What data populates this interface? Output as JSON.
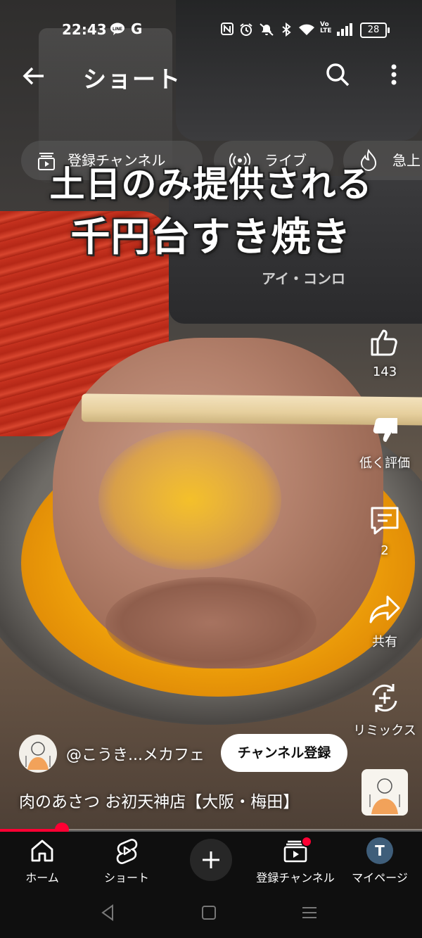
{
  "status_bar": {
    "time": "22:43",
    "line_icon_text": "LINE",
    "google_icon_text": "G",
    "battery_level": "28",
    "volte_text": "Vo LTE"
  },
  "header": {
    "title": "ショート"
  },
  "chips": [
    {
      "label": "登録チャンネル",
      "icon": "subscriptions-icon"
    },
    {
      "label": "ライブ",
      "icon": "live-icon"
    },
    {
      "label": "急上",
      "icon": "trending-icon"
    }
  ],
  "caption": {
    "line1": "土日のみ提供される",
    "line2": "千円台すき焼き"
  },
  "background": {
    "appliance_text": "アイ・コンロ"
  },
  "actions": {
    "like_count": "143",
    "dislike_label": "低く評価",
    "comment_count": "2",
    "share_label": "共有",
    "remix_label": "リミックス"
  },
  "channel": {
    "name": "@こうき...メカフェ",
    "subscribe_label": "チャンネル登録"
  },
  "video": {
    "title": "肉のあさつ お初天神店【大阪・梅田】",
    "progress_fraction": 0.147
  },
  "bottom_nav": [
    {
      "label": "ホーム",
      "icon": "home-icon"
    },
    {
      "label": "ショート",
      "icon": "shorts-icon"
    },
    {
      "label": "",
      "icon": "create-icon"
    },
    {
      "label": "登録チャンネル",
      "icon": "subscriptions-icon"
    },
    {
      "label": "マイページ",
      "icon": "avatar"
    }
  ],
  "my_page_initial": "T",
  "colors": {
    "accent": "#ff0033",
    "nav_bg": "#0f0f0f",
    "subscribe_bg": "#ffffff",
    "avatar_bg": "#3f5e7a"
  }
}
